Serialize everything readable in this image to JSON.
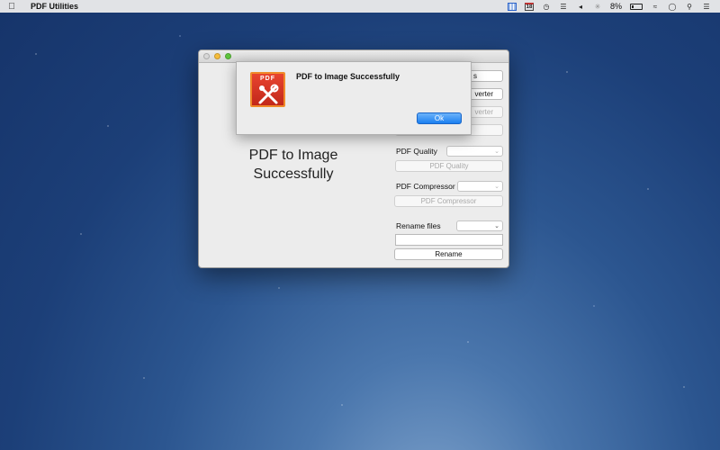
{
  "menubar": {
    "app_name": "PDF Utilities",
    "calendar_day": "18",
    "battery_percent": "8%",
    "icons": [
      "apple-icon",
      "grid-icon",
      "calendar-icon",
      "clock-icon",
      "list-icon",
      "volume-icon",
      "bluetooth-icon",
      "battery-icon",
      "wifi-icon",
      "user-icon",
      "search-icon",
      "notification-icon"
    ]
  },
  "window": {
    "status_message": "PDF to Image Successfully",
    "buttons": {
      "top_1": "s",
      "top_2": "verter",
      "top_3": "verter",
      "pdf_quality": "PDF Quality",
      "pdf_compressor": "PDF Compressor",
      "rename": "Rename"
    },
    "labels": {
      "pdf_quality": "PDF Quality",
      "pdf_compressor": "PDF Compressor",
      "rename_files": "Rename files"
    },
    "rename_field_value": ""
  },
  "alert": {
    "title": "PDF to Image Successfully",
    "app_icon_text": "PDF",
    "ok_label": "Ok"
  },
  "colors": {
    "accent_blue": "#1a7ff0",
    "icon_red": "#d9352a",
    "icon_border": "#f08a2a"
  }
}
